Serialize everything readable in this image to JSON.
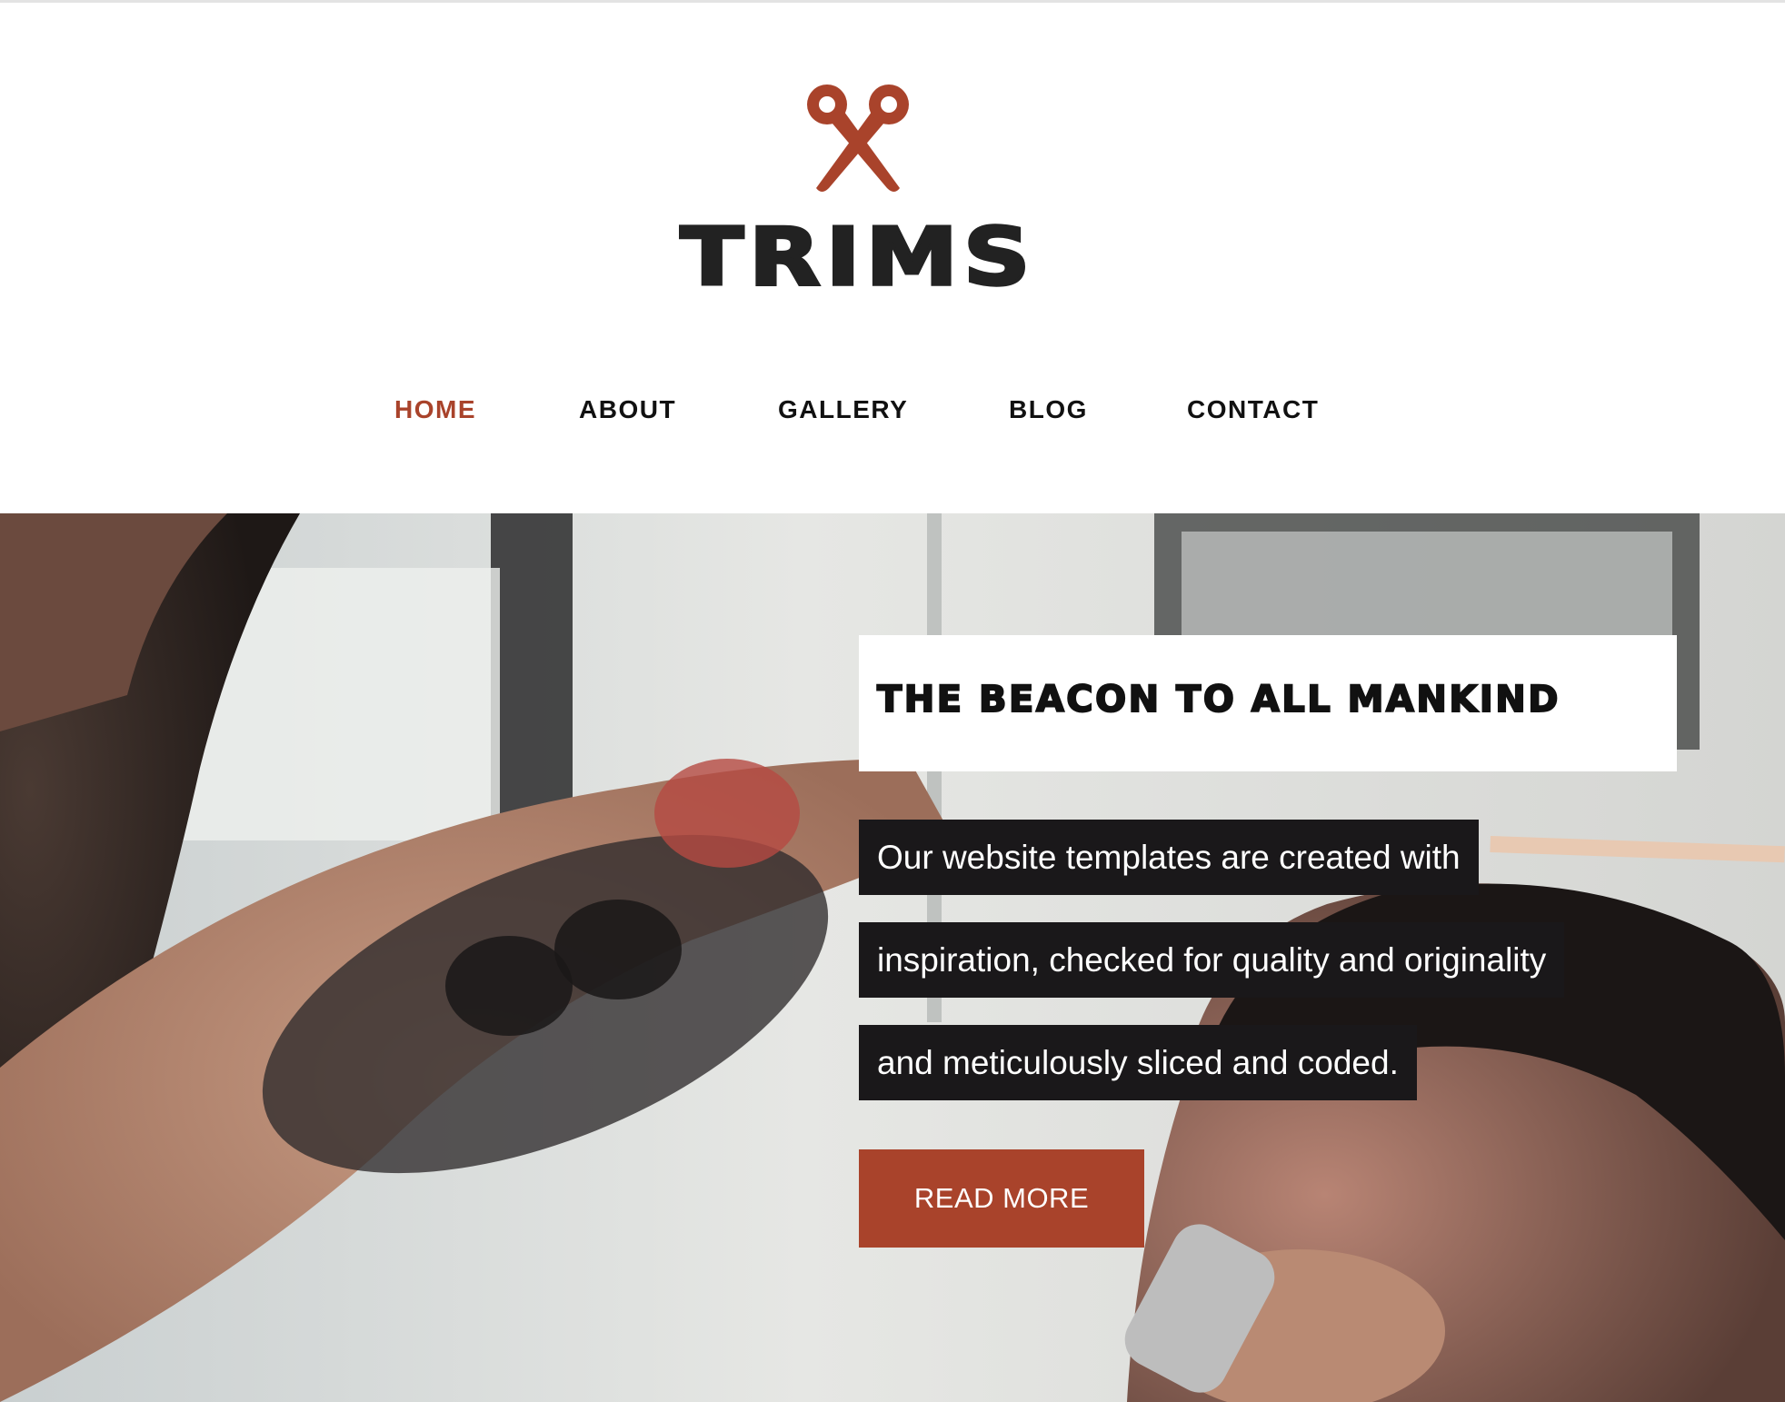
{
  "brand": {
    "name": "TRIMS",
    "logo_icon": "scissors-icon",
    "accent_color": "#a9432b",
    "text_color": "#222222"
  },
  "nav": {
    "items": [
      {
        "label": "HOME",
        "active": true
      },
      {
        "label": "ABOUT",
        "active": false
      },
      {
        "label": "GALLERY",
        "active": false
      },
      {
        "label": "BLOG",
        "active": false
      },
      {
        "label": "CONTACT",
        "active": false
      }
    ]
  },
  "hero": {
    "headline": "THE BEACON TO ALL MANKIND",
    "paragraph_lines": [
      "Our website templates are created with",
      "inspiration, checked for quality and originality",
      "and meticulously sliced and coded."
    ],
    "cta_label": "READ MORE",
    "background_image": "barber-cutting-hair-photo"
  }
}
